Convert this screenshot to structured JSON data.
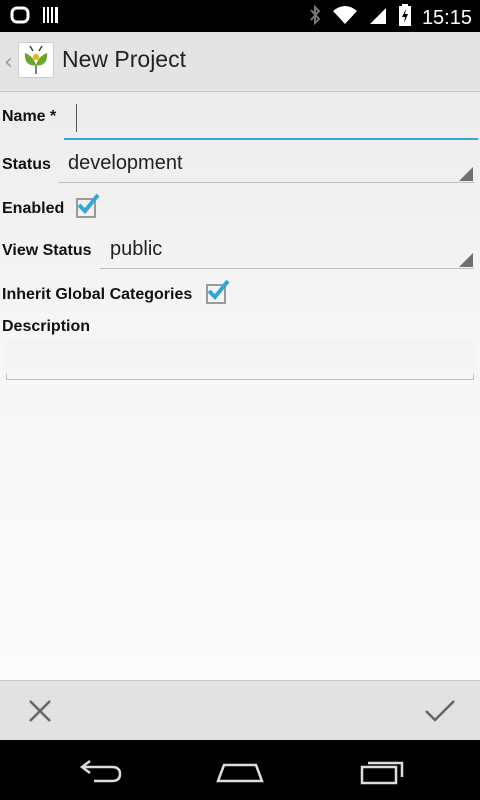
{
  "status_bar": {
    "time": "15:15",
    "icons": [
      "notification-icon",
      "barcode-icon",
      "bluetooth-icon",
      "wifi-icon",
      "signal-icon",
      "battery-icon"
    ]
  },
  "action_bar": {
    "title": "New Project",
    "icon": "mantis-bug-logo-icon"
  },
  "form": {
    "name_label": "Name *",
    "name_value": "",
    "status_label": "Status",
    "status_value": "development",
    "enabled_label": "Enabled",
    "enabled_checked": true,
    "view_status_label": "View Status",
    "view_status_value": "public",
    "inherit_label": "Inherit Global Categories",
    "inherit_checked": true,
    "description_label": "Description",
    "description_value": ""
  },
  "bottom_bar": {
    "cancel_icon": "close-icon",
    "confirm_icon": "checkmark-icon"
  },
  "colors": {
    "accent": "#33a5d6",
    "actionbar_bg": "#e4e4e4",
    "statusbar_bg": "#000000"
  }
}
